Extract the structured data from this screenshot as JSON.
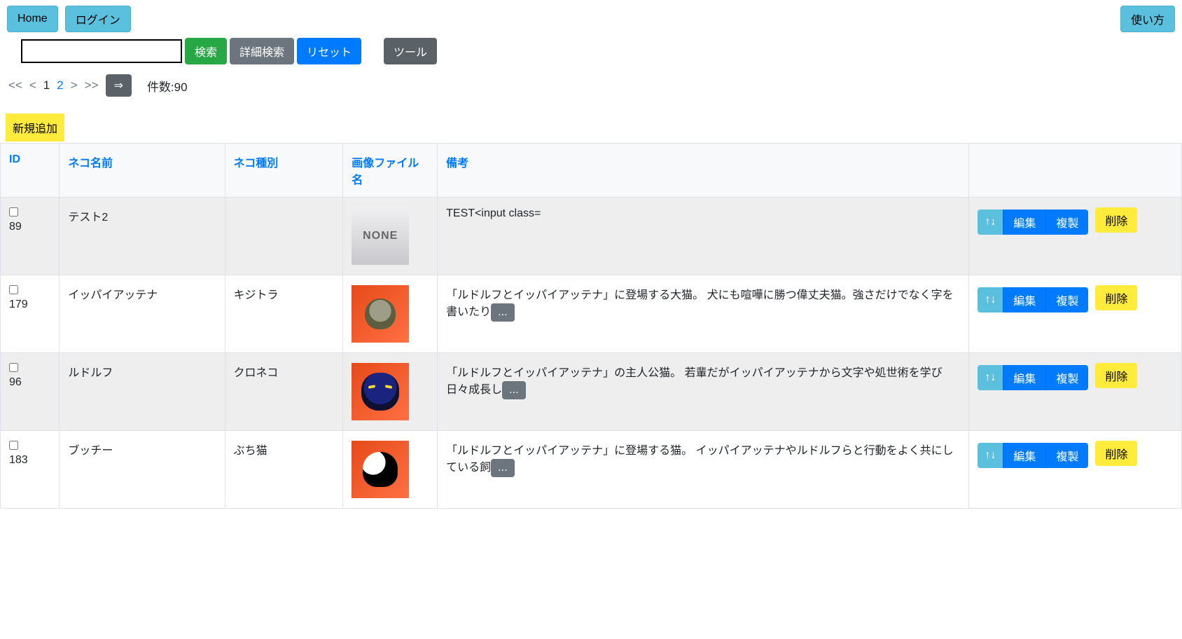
{
  "topbar": {
    "home": "Home",
    "login": "ログイン",
    "help": "使い方"
  },
  "toolbar": {
    "search": "検索",
    "adv_search": "詳細検索",
    "reset": "リセット",
    "tool": "ツール",
    "search_value": ""
  },
  "pager": {
    "first": "<<",
    "prev": "<",
    "p1": "1",
    "p2": "2",
    "next": ">",
    "last": ">>",
    "arrow": "⇒",
    "count": "件数:90"
  },
  "addnew": "新規追加",
  "columns": {
    "id": "ID",
    "name": "ネコ名前",
    "kind": "ネコ種別",
    "img": "画像ファイル名",
    "note": "備考"
  },
  "rows": [
    {
      "id": "89",
      "name": "テスト2",
      "kind": "",
      "thumb": "none",
      "note": "TEST<input class=",
      "more": false
    },
    {
      "id": "179",
      "name": "イッパイアッテナ",
      "kind": "キジトラ",
      "thumb": "a",
      "note": "「ルドルフとイッパイアッテナ」に登場する大猫。 犬にも喧嘩に勝つ偉丈夫猫。強さだけでなく字を書いたり",
      "more": true
    },
    {
      "id": "96",
      "name": "ルドルフ",
      "kind": "クロネコ",
      "thumb": "b",
      "note": "「ルドルフとイッパイアッテナ」の主人公猫。 若輩だがイッパイアッテナから文字や処世術を学び日々成長し",
      "more": true
    },
    {
      "id": "183",
      "name": "ブッチー",
      "kind": "ぶち猫",
      "thumb": "c",
      "note": "「ルドルフとイッパイアッテナ」に登場する猫。 イッパイアッテナやルドルフらと行動をよく共にしている飼",
      "more": true
    }
  ],
  "actions": {
    "sort": "↑↓",
    "edit": "編集",
    "copy": "複製",
    "del": "削除",
    "more": "..."
  }
}
